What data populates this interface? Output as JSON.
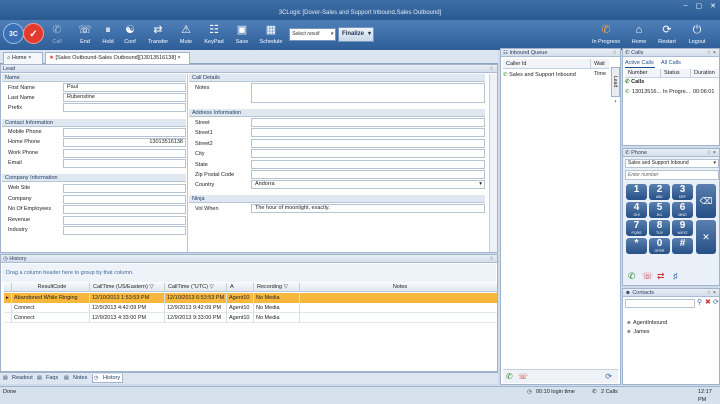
{
  "window": {
    "title": "3CLogic [Dover-Sales and Support Inbound,Sales Outbound]"
  },
  "ribbon": {
    "buttons": [
      {
        "label": "Call",
        "icon": "phone-icon"
      },
      {
        "label": "End",
        "icon": "phone-hangup-icon"
      },
      {
        "label": "Hold",
        "icon": "hold-icon"
      },
      {
        "label": "Conf",
        "icon": "conference-icon"
      },
      {
        "label": "Transfer",
        "icon": "transfer-icon"
      },
      {
        "label": "Mute",
        "icon": "mute-icon"
      },
      {
        "label": "KeyPad",
        "icon": "keypad-icon"
      },
      {
        "label": "Save",
        "icon": "save-icon"
      },
      {
        "label": "Schedule",
        "icon": "calendar-icon"
      }
    ],
    "result_select": {
      "value": "Select result"
    },
    "finalize_label": "Finalize",
    "right_buttons": [
      {
        "label": "In Progress",
        "icon": "phone-progress-icon"
      },
      {
        "label": "Home",
        "icon": "home-icon"
      },
      {
        "label": "Restart",
        "icon": "restart-icon"
      },
      {
        "label": "Logout",
        "icon": "logout-icon"
      }
    ]
  },
  "tabs": [
    {
      "label": "Home"
    },
    {
      "label": "[Sales Outbound-Sales Outbound][13013516138]"
    }
  ],
  "lead": {
    "title": "Lead",
    "name_section": "Name",
    "first_name_label": "First Name",
    "first_name": "Paul",
    "last_name_label": "Last Name",
    "last_name": "Rubenstine",
    "prefix_label": "Prefix",
    "contact_section": "Contact Information",
    "mobile_label": "Mobile Phone",
    "home_phone_label": "Home Phone",
    "home_phone": "13013516138",
    "work_phone_label": "Work Phone",
    "email_label": "Email",
    "company_section": "Company Information",
    "website_label": "Web Site",
    "company_label": "Company",
    "employees_label": "No Of Employees",
    "revenue_label": "Revenue",
    "industry_label": "Industry",
    "call_details_section": "Call Details",
    "notes_label": "Notes",
    "address_section": "Address Information",
    "street_label": "Street",
    "street1_label": "Street1",
    "street2_label": "Street2",
    "city_label": "City",
    "state_label": "State",
    "zip_label": "Zip Postal Code",
    "country_label": "Country",
    "country": "Andorra",
    "ninja_section": "Ninja",
    "vol_when_label": "Vol When",
    "vol_when": "The hour of moonlight, exactly."
  },
  "history": {
    "title": "History",
    "group_hint": "Drag a column header here to group by that column.",
    "columns": [
      "ResultCode",
      "CallTime (US/Eastern)",
      "CallTime (\"UTC)",
      "A",
      "Recording",
      "Notes"
    ],
    "rows": [
      {
        "result": "Abandoned While Ringing",
        "time_local": "12/10/2013 1:53:53 PM",
        "time_utc": "12/10/2013 6:53:53 PM",
        "agent": "Agent10",
        "recording": "No Media",
        "notes": ""
      },
      {
        "result": "Connect",
        "time_local": "12/9/2013 4:42:09 PM",
        "time_utc": "12/9/2013 9:42:09 PM",
        "agent": "Agent10",
        "recording": "No Media",
        "notes": ""
      },
      {
        "result": "Connect",
        "time_local": "12/9/2013 4:33:00 PM",
        "time_utc": "12/9/2013 9:33:00 PM",
        "agent": "Agent10",
        "recording": "No Media",
        "notes": ""
      }
    ]
  },
  "bottom_tabs": [
    "Readout",
    "Faqs",
    "Notes",
    "History"
  ],
  "inbound_queue": {
    "title": "Inbound Queue",
    "columns": [
      "Caller Id",
      "Wait Time"
    ],
    "rows": [
      {
        "caller": "Sales and Support Inbound",
        "wait": ""
      }
    ],
    "side_tab": "Lead"
  },
  "calls": {
    "title": "Calls",
    "tabs": [
      "Active Calls",
      "All Calls"
    ],
    "columns": [
      "Number",
      "Status",
      "Duration"
    ],
    "group": "Calls",
    "rows": [
      {
        "number": "13013516...",
        "status": "In Progre...",
        "duration": "00:06:01"
      }
    ]
  },
  "phone": {
    "title": "Phone",
    "queue": "Sales and Support Inbound",
    "number_placeholder": "Enter number",
    "keys": [
      {
        "digit": "1",
        "letters": ""
      },
      {
        "digit": "2",
        "letters": "ABC"
      },
      {
        "digit": "3",
        "letters": "DEF"
      },
      {
        "digit": "4",
        "letters": "GHI"
      },
      {
        "digit": "5",
        "letters": "JKL"
      },
      {
        "digit": "6",
        "letters": "MNO"
      },
      {
        "digit": "7",
        "letters": "PQRS"
      },
      {
        "digit": "8",
        "letters": "TUV"
      },
      {
        "digit": "9",
        "letters": "WXYZ"
      },
      {
        "digit": "*",
        "letters": ""
      },
      {
        "digit": "0",
        "letters": "OPER"
      },
      {
        "digit": "#",
        "letters": ""
      }
    ]
  },
  "contacts": {
    "title": "Contacts",
    "items": [
      "AgentInbound",
      "James"
    ]
  },
  "status": {
    "left": "Done",
    "login_time": "00:10 login time",
    "calls_count": "2 Calls",
    "clock": "12:17 PM"
  },
  "colors": {
    "accent": "#2e5e98",
    "highlight_row": "#f6b73c"
  }
}
